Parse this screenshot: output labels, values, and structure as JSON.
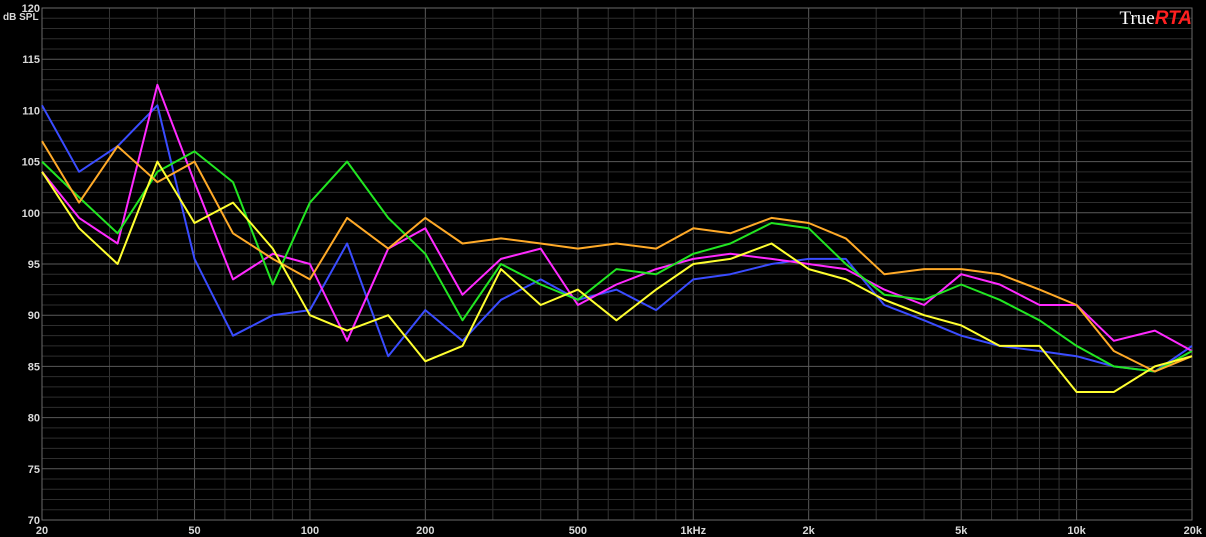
{
  "logo": {
    "true_text": "True",
    "rta_text": "RTA"
  },
  "chart_data": {
    "type": "line",
    "ylabel": "dB SPL",
    "xscale": "log",
    "xlim": [
      20,
      20000
    ],
    "ylim": [
      70,
      120
    ],
    "grid": true,
    "x_ticks": [
      {
        "value": 20,
        "label": "20"
      },
      {
        "value": 50,
        "label": "50"
      },
      {
        "value": 100,
        "label": "100"
      },
      {
        "value": 200,
        "label": "200"
      },
      {
        "value": 500,
        "label": "500"
      },
      {
        "value": 1000,
        "label": "1kHz"
      },
      {
        "value": 2000,
        "label": "2k"
      },
      {
        "value": 5000,
        "label": "5k"
      },
      {
        "value": 10000,
        "label": "10k"
      },
      {
        "value": 20000,
        "label": "20k"
      }
    ],
    "y_ticks": [
      {
        "value": 120,
        "label": "120"
      },
      {
        "value": 115,
        "label": "115"
      },
      {
        "value": 110,
        "label": "110"
      },
      {
        "value": 105,
        "label": "105"
      },
      {
        "value": 100,
        "label": "100"
      },
      {
        "value": 95,
        "label": "95"
      },
      {
        "value": 90,
        "label": "90"
      },
      {
        "value": 85,
        "label": "85"
      },
      {
        "value": 80,
        "label": "80"
      },
      {
        "value": 75,
        "label": "75"
      },
      {
        "value": 70,
        "label": "70"
      }
    ],
    "x": [
      20,
      25,
      31.5,
      40,
      50,
      63,
      80,
      100,
      125,
      160,
      200,
      250,
      315,
      400,
      500,
      630,
      800,
      1000,
      1250,
      1600,
      2000,
      2500,
      3150,
      4000,
      5000,
      6300,
      8000,
      10000,
      12500,
      16000,
      20000
    ],
    "series": [
      {
        "color": "#3a4cff",
        "values": [
          110.5,
          104,
          106.5,
          110.5,
          95.5,
          88,
          90,
          90.5,
          97,
          86,
          90.5,
          87.5,
          91.5,
          93.5,
          91.5,
          92.5,
          90.5,
          93.5,
          94,
          95,
          95.5,
          95.5,
          91,
          89.5,
          88,
          87,
          86.5,
          86,
          85,
          84.5,
          87
        ]
      },
      {
        "color": "#ff2aff",
        "values": [
          104,
          99.5,
          97,
          112.5,
          103,
          93.5,
          96,
          95,
          87.5,
          96.5,
          98.5,
          92,
          95.5,
          96.5,
          91,
          93,
          94.5,
          95.5,
          96,
          95.5,
          95,
          94.5,
          92.5,
          91,
          94,
          93,
          91,
          91,
          87.5,
          88.5,
          86.5
        ]
      },
      {
        "color": "#22e622",
        "values": [
          105,
          101.5,
          98,
          104,
          106,
          103,
          93,
          101,
          105,
          99.5,
          96,
          89.5,
          95,
          93,
          91.5,
          94.5,
          94,
          96,
          97,
          99,
          98.5,
          95,
          92,
          91.5,
          93,
          91.5,
          89.5,
          87,
          85,
          84.5,
          86.5
        ]
      },
      {
        "color": "#ffaa28",
        "values": [
          107,
          101,
          106.5,
          103,
          105,
          98,
          95.5,
          93.5,
          99.5,
          96.5,
          99.5,
          97,
          97.5,
          97,
          96.5,
          97,
          96.5,
          98.5,
          98,
          99.5,
          99,
          97.5,
          94,
          94.5,
          94.5,
          94,
          92.5,
          91,
          86.5,
          84.5,
          86
        ]
      },
      {
        "color": "#ffff30",
        "values": [
          104,
          98.5,
          95,
          105,
          99,
          101,
          96.5,
          90,
          88.5,
          90,
          85.5,
          87,
          94.5,
          91,
          92.5,
          89.5,
          92.5,
          95,
          95.5,
          97,
          94.5,
          93.5,
          91.5,
          90,
          89,
          87,
          87,
          82.5,
          82.5,
          85,
          86
        ]
      }
    ]
  }
}
